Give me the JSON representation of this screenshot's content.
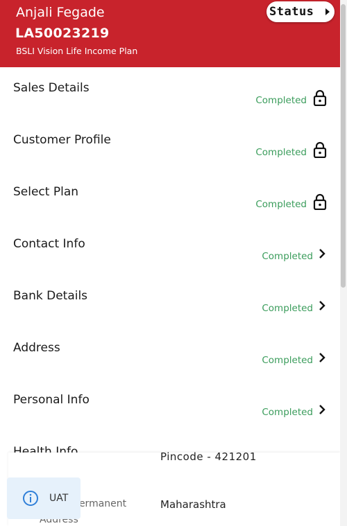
{
  "header": {
    "customer_name": "Anjali Fegade",
    "policy_number": "LA50023219",
    "plan_name": "BSLI Vision Life Income Plan",
    "status_label": "Status"
  },
  "sections": [
    {
      "title": "Sales Details",
      "status": "Completed",
      "icon": "lock-icon"
    },
    {
      "title": "Customer Profile",
      "status": "Completed",
      "icon": "lock-icon"
    },
    {
      "title": "Select Plan",
      "status": "Completed",
      "icon": "lock-icon"
    },
    {
      "title": "Contact Info",
      "status": "Completed",
      "icon": "chevron-right-icon"
    },
    {
      "title": "Bank Details",
      "status": "Completed",
      "icon": "chevron-right-icon"
    },
    {
      "title": "Address",
      "status": "Completed",
      "icon": "chevron-right-icon"
    },
    {
      "title": "Personal Info",
      "status": "Completed",
      "icon": "chevron-right-icon"
    },
    {
      "title": "Health Info"
    }
  ],
  "address_panel": {
    "pincode": "Pincode - 421201",
    "label_permanent": "Permanent",
    "label_address": "Address",
    "state": "Maharashtra"
  },
  "toast": {
    "icon": "info-icon",
    "text": "UAT"
  },
  "colors": {
    "header_bg": "#c8232c",
    "completed_text": "#3a9c5b",
    "toast_bg": "#e6f1fb"
  }
}
